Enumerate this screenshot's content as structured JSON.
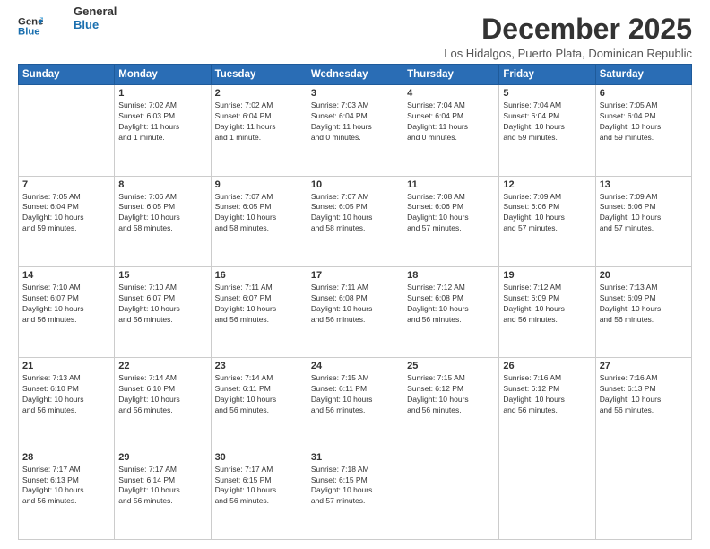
{
  "logo": {
    "line1": "General",
    "line2": "Blue"
  },
  "title": "December 2025",
  "location": "Los Hidalgos, Puerto Plata, Dominican Republic",
  "headers": [
    "Sunday",
    "Monday",
    "Tuesday",
    "Wednesday",
    "Thursday",
    "Friday",
    "Saturday"
  ],
  "weeks": [
    [
      {
        "day": "",
        "info": ""
      },
      {
        "day": "1",
        "info": "Sunrise: 7:02 AM\nSunset: 6:03 PM\nDaylight: 11 hours\nand 1 minute."
      },
      {
        "day": "2",
        "info": "Sunrise: 7:02 AM\nSunset: 6:04 PM\nDaylight: 11 hours\nand 1 minute."
      },
      {
        "day": "3",
        "info": "Sunrise: 7:03 AM\nSunset: 6:04 PM\nDaylight: 11 hours\nand 0 minutes."
      },
      {
        "day": "4",
        "info": "Sunrise: 7:04 AM\nSunset: 6:04 PM\nDaylight: 11 hours\nand 0 minutes."
      },
      {
        "day": "5",
        "info": "Sunrise: 7:04 AM\nSunset: 6:04 PM\nDaylight: 10 hours\nand 59 minutes."
      },
      {
        "day": "6",
        "info": "Sunrise: 7:05 AM\nSunset: 6:04 PM\nDaylight: 10 hours\nand 59 minutes."
      }
    ],
    [
      {
        "day": "7",
        "info": "Sunrise: 7:05 AM\nSunset: 6:04 PM\nDaylight: 10 hours\nand 59 minutes."
      },
      {
        "day": "8",
        "info": "Sunrise: 7:06 AM\nSunset: 6:05 PM\nDaylight: 10 hours\nand 58 minutes."
      },
      {
        "day": "9",
        "info": "Sunrise: 7:07 AM\nSunset: 6:05 PM\nDaylight: 10 hours\nand 58 minutes."
      },
      {
        "day": "10",
        "info": "Sunrise: 7:07 AM\nSunset: 6:05 PM\nDaylight: 10 hours\nand 58 minutes."
      },
      {
        "day": "11",
        "info": "Sunrise: 7:08 AM\nSunset: 6:06 PM\nDaylight: 10 hours\nand 57 minutes."
      },
      {
        "day": "12",
        "info": "Sunrise: 7:09 AM\nSunset: 6:06 PM\nDaylight: 10 hours\nand 57 minutes."
      },
      {
        "day": "13",
        "info": "Sunrise: 7:09 AM\nSunset: 6:06 PM\nDaylight: 10 hours\nand 57 minutes."
      }
    ],
    [
      {
        "day": "14",
        "info": "Sunrise: 7:10 AM\nSunset: 6:07 PM\nDaylight: 10 hours\nand 56 minutes."
      },
      {
        "day": "15",
        "info": "Sunrise: 7:10 AM\nSunset: 6:07 PM\nDaylight: 10 hours\nand 56 minutes."
      },
      {
        "day": "16",
        "info": "Sunrise: 7:11 AM\nSunset: 6:07 PM\nDaylight: 10 hours\nand 56 minutes."
      },
      {
        "day": "17",
        "info": "Sunrise: 7:11 AM\nSunset: 6:08 PM\nDaylight: 10 hours\nand 56 minutes."
      },
      {
        "day": "18",
        "info": "Sunrise: 7:12 AM\nSunset: 6:08 PM\nDaylight: 10 hours\nand 56 minutes."
      },
      {
        "day": "19",
        "info": "Sunrise: 7:12 AM\nSunset: 6:09 PM\nDaylight: 10 hours\nand 56 minutes."
      },
      {
        "day": "20",
        "info": "Sunrise: 7:13 AM\nSunset: 6:09 PM\nDaylight: 10 hours\nand 56 minutes."
      }
    ],
    [
      {
        "day": "21",
        "info": "Sunrise: 7:13 AM\nSunset: 6:10 PM\nDaylight: 10 hours\nand 56 minutes."
      },
      {
        "day": "22",
        "info": "Sunrise: 7:14 AM\nSunset: 6:10 PM\nDaylight: 10 hours\nand 56 minutes."
      },
      {
        "day": "23",
        "info": "Sunrise: 7:14 AM\nSunset: 6:11 PM\nDaylight: 10 hours\nand 56 minutes."
      },
      {
        "day": "24",
        "info": "Sunrise: 7:15 AM\nSunset: 6:11 PM\nDaylight: 10 hours\nand 56 minutes."
      },
      {
        "day": "25",
        "info": "Sunrise: 7:15 AM\nSunset: 6:12 PM\nDaylight: 10 hours\nand 56 minutes."
      },
      {
        "day": "26",
        "info": "Sunrise: 7:16 AM\nSunset: 6:12 PM\nDaylight: 10 hours\nand 56 minutes."
      },
      {
        "day": "27",
        "info": "Sunrise: 7:16 AM\nSunset: 6:13 PM\nDaylight: 10 hours\nand 56 minutes."
      }
    ],
    [
      {
        "day": "28",
        "info": "Sunrise: 7:17 AM\nSunset: 6:13 PM\nDaylight: 10 hours\nand 56 minutes."
      },
      {
        "day": "29",
        "info": "Sunrise: 7:17 AM\nSunset: 6:14 PM\nDaylight: 10 hours\nand 56 minutes."
      },
      {
        "day": "30",
        "info": "Sunrise: 7:17 AM\nSunset: 6:15 PM\nDaylight: 10 hours\nand 56 minutes."
      },
      {
        "day": "31",
        "info": "Sunrise: 7:18 AM\nSunset: 6:15 PM\nDaylight: 10 hours\nand 57 minutes."
      },
      {
        "day": "",
        "info": ""
      },
      {
        "day": "",
        "info": ""
      },
      {
        "day": "",
        "info": ""
      }
    ]
  ]
}
